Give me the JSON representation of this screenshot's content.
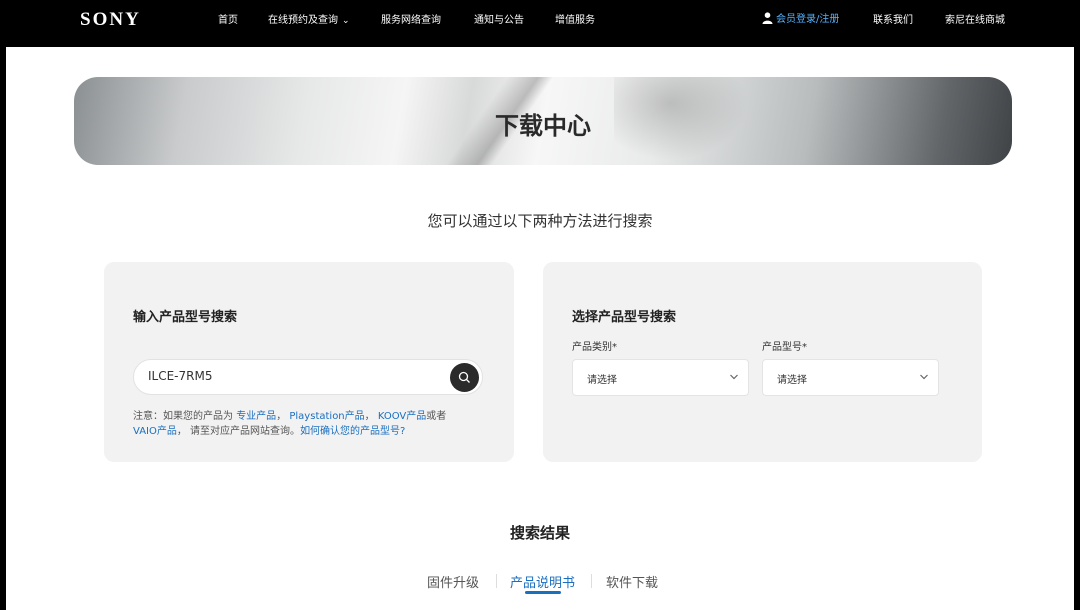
{
  "header": {
    "logo": "SONY",
    "nav": [
      "首页",
      "在线预约及查询",
      "服务网络查询",
      "通知与公告",
      "增值服务"
    ],
    "login": "会员登录/注册",
    "contact": "联系我们",
    "store": "索尼在线商城"
  },
  "hero": {
    "title": "下载中心"
  },
  "subtitle": "您可以通过以下两种方法进行搜索",
  "model_search": {
    "title": "输入产品型号搜索",
    "input_value": "ILCE-7RM5",
    "note": {
      "prefix": "注意：如果您的产品为",
      "link_pro": "专业产品",
      "sep1": "，",
      "link_ps": "Playstation产品",
      "sep2": "，",
      "link_koov": "KOOV产品",
      "or": "或者",
      "link_vaio": "VAIO产品",
      "mid": "， 请至对应产品网站查询。",
      "link_how": "如何确认您的产品型号?"
    }
  },
  "select_search": {
    "title": "选择产品型号搜索",
    "category_label": "产品类别*",
    "category_value": "请选择",
    "model_label": "产品型号*",
    "model_value": "请选择"
  },
  "results": {
    "title": "搜索结果",
    "tabs": [
      "固件升级",
      "产品说明书",
      "软件下载"
    ],
    "active_tab": 1
  },
  "colors": {
    "link": "#1a6fbf",
    "login": "#57b3ff",
    "topbar": "#000000"
  }
}
